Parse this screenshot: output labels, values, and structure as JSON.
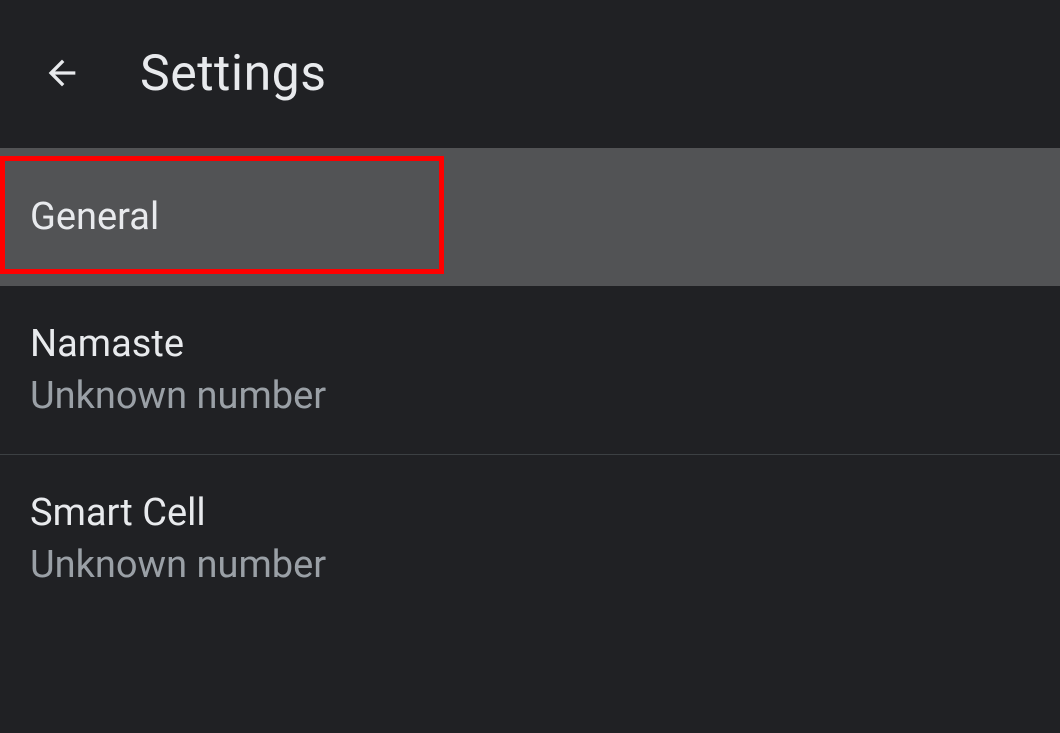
{
  "header": {
    "title": "Settings"
  },
  "items": [
    {
      "title": "General"
    },
    {
      "title": "Namaste",
      "subtitle": "Unknown number"
    },
    {
      "title": "Smart Cell",
      "subtitle": "Unknown number"
    }
  ]
}
